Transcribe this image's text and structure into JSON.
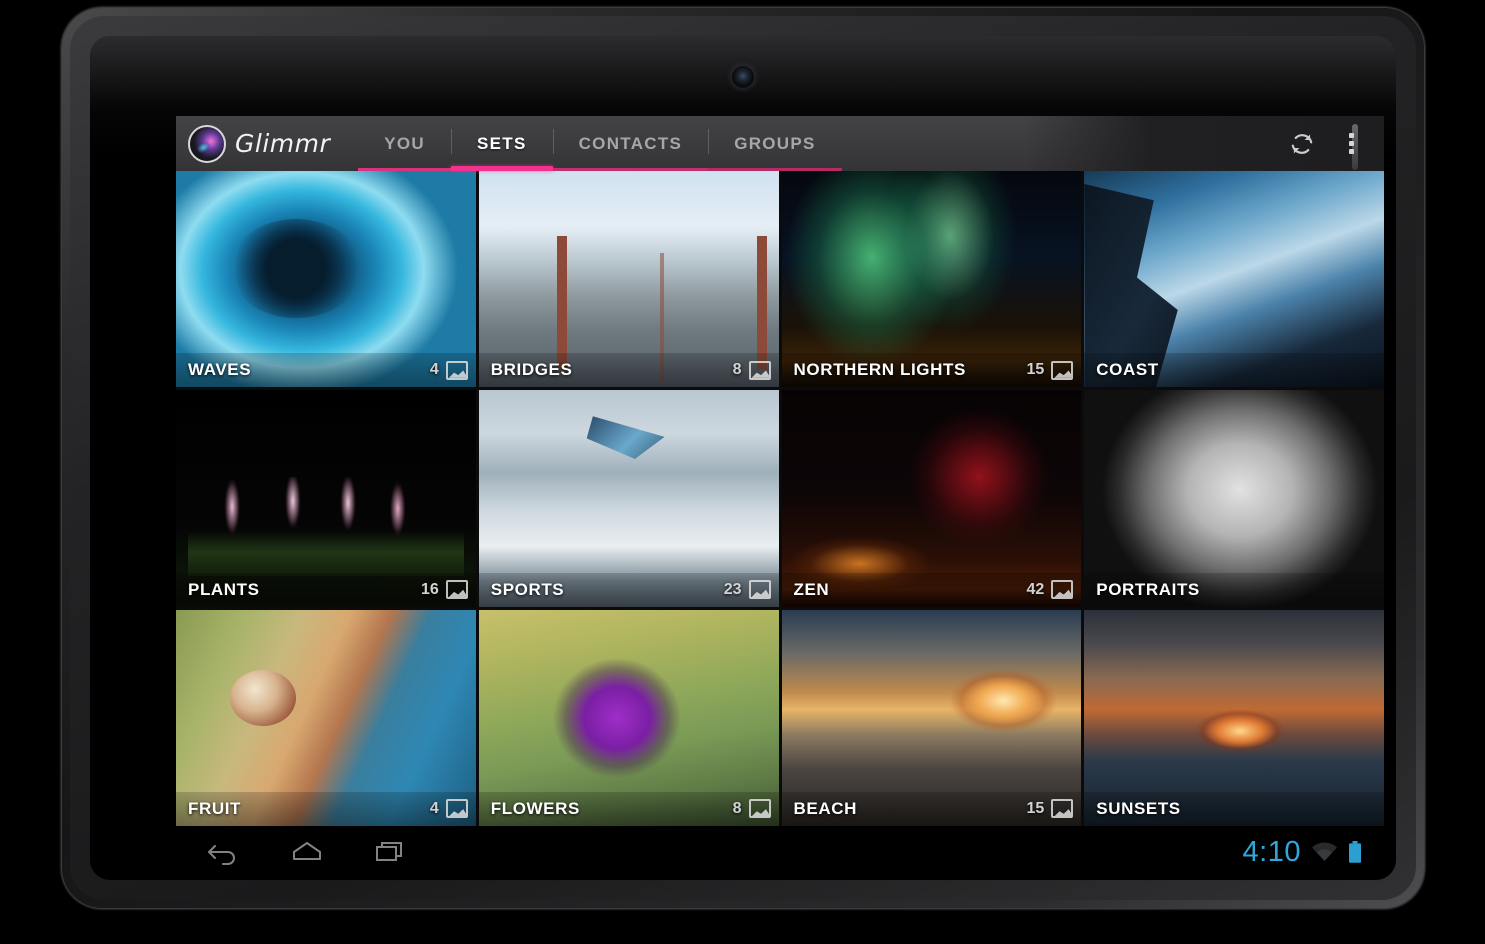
{
  "app": {
    "brand_name": "Glimmr",
    "logo_icon": "camera-lens-logo",
    "accent_color": "#f2328c",
    "action_bar_bg": "#3b3b3d"
  },
  "tabs": [
    {
      "label": "YOU",
      "selected": false
    },
    {
      "label": "SETS",
      "selected": true
    },
    {
      "label": "CONTACTS",
      "selected": false
    },
    {
      "label": "GROUPS",
      "selected": false
    }
  ],
  "action_icons": [
    {
      "name": "refresh-icon",
      "label": "Refresh"
    },
    {
      "name": "overflow-menu-icon",
      "label": "More options"
    }
  ],
  "sets": [
    {
      "name": "WAVES",
      "count": "4",
      "photo": "p-waves",
      "count_visible": true
    },
    {
      "name": "BRIDGES",
      "count": "8",
      "photo": "p-bridges",
      "count_visible": true
    },
    {
      "name": "NORTHERN LIGHTS",
      "count": "15",
      "photo": "p-northern",
      "count_visible": true
    },
    {
      "name": "COAST",
      "count": "",
      "photo": "p-coast",
      "count_visible": false
    },
    {
      "name": "PLANTS",
      "count": "16",
      "photo": "p-plants",
      "count_visible": true
    },
    {
      "name": "SPORTS",
      "count": "23",
      "photo": "p-sports",
      "count_visible": true
    },
    {
      "name": "ZEN",
      "count": "42",
      "photo": "p-zen",
      "count_visible": true
    },
    {
      "name": "PORTRAITS",
      "count": "",
      "photo": "p-portraits",
      "count_visible": false
    },
    {
      "name": "FRUIT",
      "count": "4",
      "photo": "p-fruit",
      "count_visible": true
    },
    {
      "name": "FLOWERS",
      "count": "8",
      "photo": "p-flowers",
      "count_visible": true
    },
    {
      "name": "BEACH",
      "count": "15",
      "photo": "p-beach",
      "count_visible": true
    },
    {
      "name": "SUNSETS",
      "count": "",
      "photo": "p-sunsets",
      "count_visible": false
    }
  ],
  "set_count_icon": "photo-icon",
  "navbar": {
    "keys": [
      {
        "name": "nav-back-button",
        "label": "Back"
      },
      {
        "name": "nav-home-button",
        "label": "Home"
      },
      {
        "name": "nav-recents-button",
        "label": "Recent apps"
      }
    ],
    "clock": "4:10",
    "clock_color": "#2fa8dd",
    "wifi_icon": "wifi-icon",
    "battery_icon": "battery-full-icon",
    "battery_color": "#2fa8dd"
  },
  "device": {
    "camera_icon": "front-camera",
    "power_button": "power-button"
  }
}
